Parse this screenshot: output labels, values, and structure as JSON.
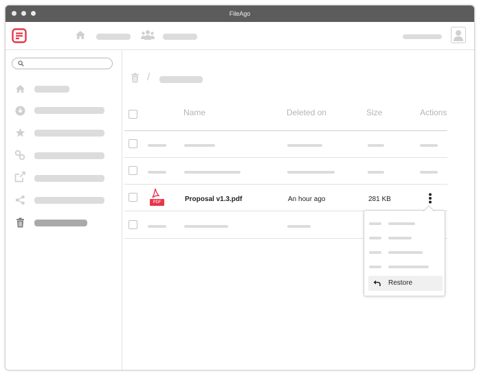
{
  "window": {
    "title": "FileAgo"
  },
  "table": {
    "headers": {
      "name": "Name",
      "deleted_on": "Deleted on",
      "size": "Size",
      "actions": "Actions"
    },
    "file_row": {
      "file_icon_label": "PDF",
      "name": "Proposal v1.3.pdf",
      "deleted_on": "An hour ago",
      "size": "281 KB"
    }
  },
  "actions_menu": {
    "restore_label": "Restore"
  },
  "colors": {
    "brand": "#e8354a",
    "titlebar": "#5c5c5c",
    "placeholder": "#dcdcdc"
  },
  "icons": [
    "fileago-logo-icon",
    "home-icon",
    "team-icon",
    "user-avatar-icon",
    "search-icon",
    "star-icon",
    "link-icon",
    "share-link-icon",
    "share-icon",
    "trash-icon",
    "pdf-file-icon",
    "kebab-menu-icon",
    "restore-icon"
  ]
}
